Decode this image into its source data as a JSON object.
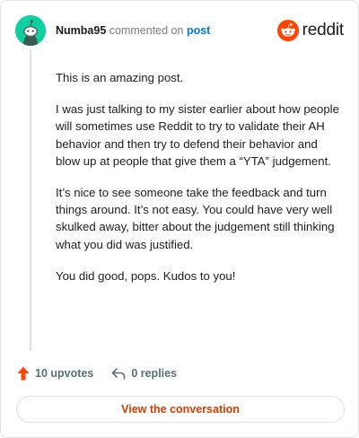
{
  "comment": {
    "author": "Numba95",
    "commented_text": "commented on",
    "post_link": "post",
    "paragraphs": [
      "This is an amazing post.",
      "I was just talking to my sister earlier about how people will sometimes use Reddit to try to validate their AH behavior and then try to defend their behavior and blow up at people that give them a “YTA” judgement.",
      "It’s nice to see someone take the feedback and turn things around. It’s not easy. You could have very well skulked away, bitter about the judgement still thinking what you did was justified.",
      "You did good, pops. Kudos to you!"
    ]
  },
  "brand": {
    "name": "reddit",
    "icon": "reddit-snoo-icon",
    "color": "#ff4500"
  },
  "avatar": {
    "icon": "snoo-avatar-icon",
    "bg_color": "#10d0a0"
  },
  "actions": {
    "upvotes_label": "10 upvotes",
    "upvote_icon": "upvote-arrow-icon",
    "upvote_color": "#ff4500",
    "replies_label": "0 replies",
    "reply_icon": "reply-arrow-icon"
  },
  "cta": {
    "label": "View the conversation",
    "color": "#d93a00"
  }
}
